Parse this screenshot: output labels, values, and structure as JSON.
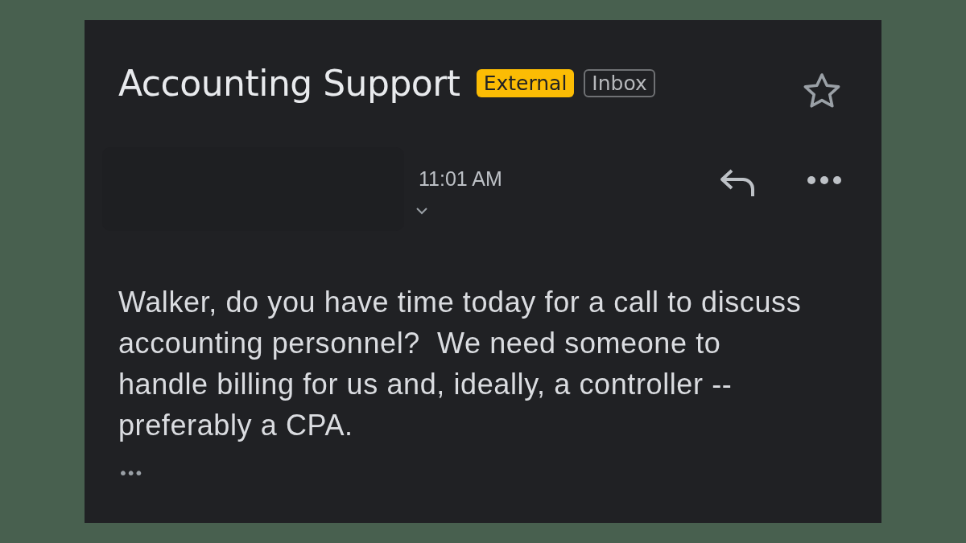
{
  "subject": "Accounting Support",
  "labels": [
    {
      "text": "External",
      "kind": "filled"
    },
    {
      "text": "Inbox",
      "kind": "outlined"
    }
  ],
  "starred": false,
  "message": {
    "time": "11:01 AM",
    "expanded": false,
    "body": "Walker, do you have time today for a call to discuss accounting personnel?  We need someone to handle billing for us and, ideally, a controller -- preferably a CPA.",
    "more": "•••"
  }
}
